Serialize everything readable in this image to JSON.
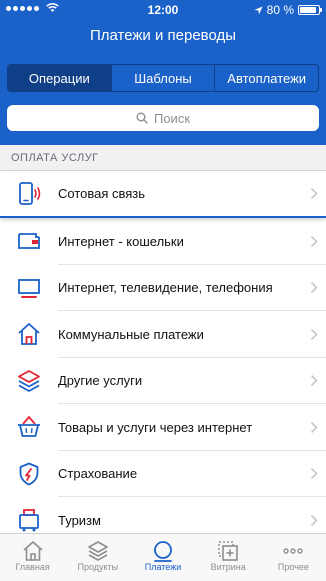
{
  "status_bar": {
    "time": "12:00",
    "battery": "80 %"
  },
  "header": {
    "title": "Платежи и переводы"
  },
  "segments": [
    {
      "label": "Операции",
      "active": true
    },
    {
      "label": "Шаблоны",
      "active": false
    },
    {
      "label": "Автоплатежи",
      "active": false
    }
  ],
  "search": {
    "placeholder": "Поиск"
  },
  "section": {
    "title": "ОПЛАТА УСЛУГ"
  },
  "services": [
    {
      "label": "Сотовая связь",
      "icon": "phone-icon"
    },
    {
      "label": "Интернет - кошельки",
      "icon": "wallet-icon"
    },
    {
      "label": "Интернет, телевидение, телефония",
      "icon": "monitor-icon"
    },
    {
      "label": "Коммунальные платежи",
      "icon": "house-icon"
    },
    {
      "label": "Другие услуги",
      "icon": "layers-icon"
    },
    {
      "label": "Товары и услуги через интернет",
      "icon": "basket-icon"
    },
    {
      "label": "Страхование",
      "icon": "shield-icon"
    },
    {
      "label": "Туризм",
      "icon": "suitcase-icon"
    }
  ],
  "tabbar": [
    {
      "label": "Главная",
      "icon": "home-icon",
      "active": false
    },
    {
      "label": "Продукты",
      "icon": "stack-icon",
      "active": false
    },
    {
      "label": "Платежи",
      "icon": "circle-icon",
      "active": true
    },
    {
      "label": "Витрина",
      "icon": "showcase-icon",
      "active": false
    },
    {
      "label": "Прочее",
      "icon": "more-icon",
      "active": false
    }
  ],
  "colors": {
    "brand": "#1a62c9",
    "brand_dark": "#0f3f86",
    "accent_red": "#e32636"
  }
}
